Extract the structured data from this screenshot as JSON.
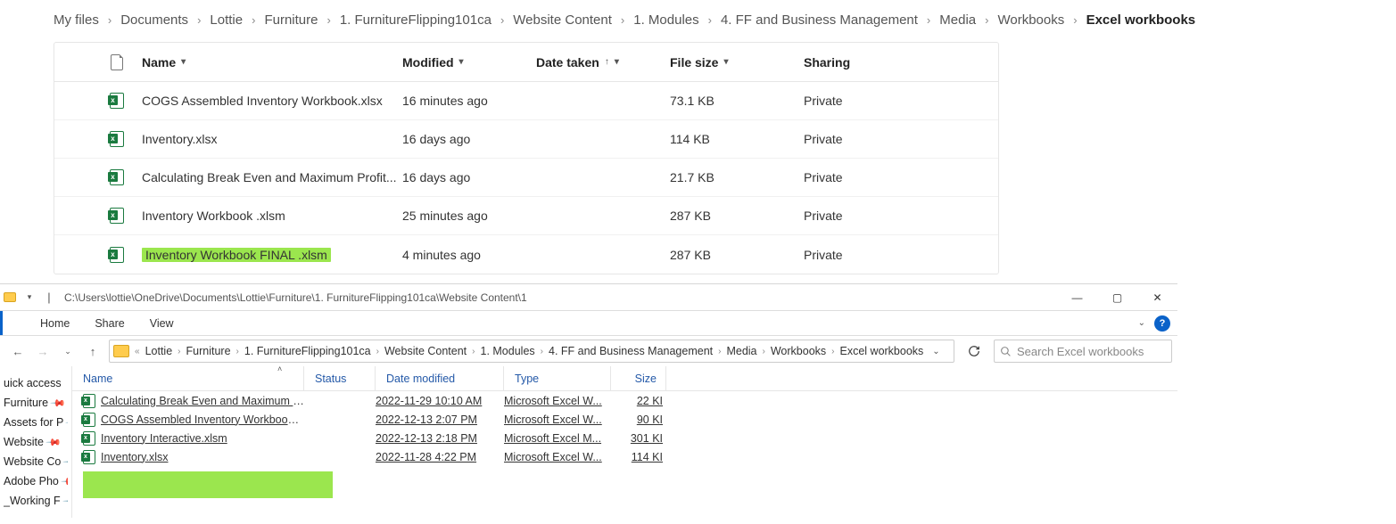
{
  "web": {
    "breadcrumbs": [
      "My files",
      "Documents",
      "Lottie",
      "Furniture",
      "1. FurnitureFlipping101ca",
      "Website Content",
      "1. Modules",
      "4. FF and Business Management",
      "Media",
      "Workbooks",
      "Excel workbooks"
    ],
    "columns": {
      "name": "Name",
      "modified": "Modified",
      "date": "Date taken",
      "size": "File size",
      "sharing": "Sharing"
    },
    "rows": [
      {
        "name": "COGS Assembled Inventory Workbook.xlsx",
        "modified": "16 minutes ago",
        "size": "73.1 KB",
        "sharing": "Private",
        "hl": false
      },
      {
        "name": "Inventory.xlsx",
        "modified": "16 days ago",
        "size": "114 KB",
        "sharing": "Private",
        "hl": false
      },
      {
        "name": "Calculating Break Even and Maximum Profit...",
        "modified": "16 days ago",
        "size": "21.7 KB",
        "sharing": "Private",
        "hl": false
      },
      {
        "name": "Inventory Workbook .xlsm",
        "modified": "25 minutes ago",
        "size": "287 KB",
        "sharing": "Private",
        "hl": false
      },
      {
        "name": "Inventory Workbook FINAL .xlsm",
        "modified": "4 minutes ago",
        "size": "287 KB",
        "sharing": "Private",
        "hl": true
      }
    ]
  },
  "explorer": {
    "titlepath": "C:\\Users\\lottie\\OneDrive\\Documents\\Lottie\\Furniture\\1. FurnitureFlipping101ca\\Website Content\\1",
    "tabs": {
      "home": "Home",
      "share": "Share",
      "view": "View"
    },
    "address": [
      "Lottie",
      "Furniture",
      "1. FurnitureFlipping101ca",
      "Website Content",
      "1. Modules",
      "4. FF and Business Management",
      "Media",
      "Workbooks",
      "Excel workbooks"
    ],
    "search_placeholder": "Search Excel workbooks",
    "side_top": "uick access",
    "side": [
      "Furniture",
      "Assets for P",
      "Website",
      "Website Co",
      "Adobe Pho",
      "_Working F"
    ],
    "cols": {
      "name": "Name",
      "status": "Status",
      "date": "Date modified",
      "type": "Type",
      "size": "Size"
    },
    "rows": [
      {
        "name": "Calculating Break Even and Maximum Pr...",
        "date": "2022-11-29 10:10 AM",
        "type": "Microsoft Excel W...",
        "size": "22 KI"
      },
      {
        "name": "COGS Assembled Inventory Workbook.xlsx",
        "date": "2022-12-13 2:07 PM",
        "type": "Microsoft Excel W...",
        "size": "90 KI"
      },
      {
        "name": "Inventory Interactive.xlsm",
        "date": "2022-12-13 2:18 PM",
        "type": "Microsoft Excel M...",
        "size": "301 KI"
      },
      {
        "name": "Inventory.xlsx",
        "date": "2022-11-28 4:22 PM",
        "type": "Microsoft Excel W...",
        "size": "114 KI"
      }
    ]
  }
}
